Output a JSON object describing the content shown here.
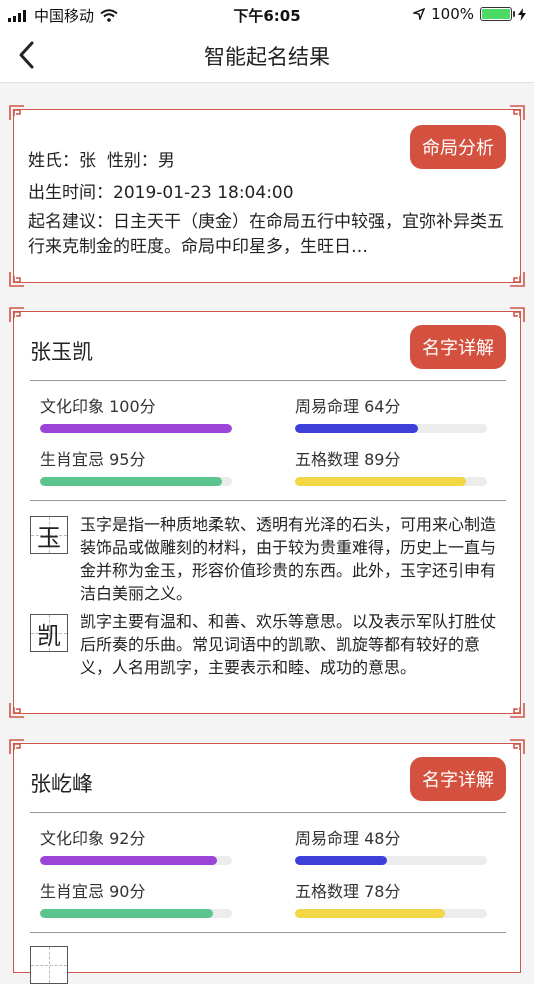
{
  "status": {
    "carrier": "中国移动",
    "time": "下午6:05",
    "battery": "100%",
    "battery_level": 1.0
  },
  "nav": {
    "title": "智能起名结果"
  },
  "summary": {
    "surname_label": "姓氏：",
    "surname": "张",
    "gender_label": "性别：",
    "gender": "男",
    "birth_label": "出生时间：",
    "birth": "2019-01-23 18:04:00",
    "advice": "起名建议：日主天干（庚金）在命局五行中较强，宜弥补异类五行来克制金的旺度。命局中印星多，生旺日…",
    "button": "命局分析"
  },
  "colors": {
    "accent": "#d5513f",
    "culture": "#9b45d9",
    "zhouyi": "#3c3fd8",
    "zodiac": "#5cc48f",
    "wuge": "#f2d646"
  },
  "names": [
    {
      "name": "张玉凯",
      "button": "名字详解",
      "metrics": [
        {
          "label": "文化印象 100分",
          "value": 100
        },
        {
          "label": "周易命理 64分",
          "value": 64
        },
        {
          "label": "生肖宜忌 95分",
          "value": 95
        },
        {
          "label": "五格数理 89分",
          "value": 89
        }
      ],
      "chars": [
        {
          "char": "玉",
          "desc": "玉字是指一种质地柔软、透明有光泽的石头，可用来心制造装饰品或做雕刻的材料，由于较为贵重难得，历史上一直与金并称为金玉，形容价值珍贵的东西。此外，玉字还引申有洁白美丽之义。"
        },
        {
          "char": "凯",
          "desc": "凯字主要有温和、和善、欢乐等意思。以及表示军队打胜仗后所奏的乐曲。常见词语中的凯歌、凯旋等都有较好的意义，人名用凯字，主要表示和睦、成功的意思。"
        }
      ]
    },
    {
      "name": "张屹峰",
      "button": "名字详解",
      "metrics": [
        {
          "label": "文化印象 92分",
          "value": 92
        },
        {
          "label": "周易命理 48分",
          "value": 48
        },
        {
          "label": "生肖宜忌 90分",
          "value": 90
        },
        {
          "label": "五格数理 78分",
          "value": 78
        }
      ]
    }
  ]
}
